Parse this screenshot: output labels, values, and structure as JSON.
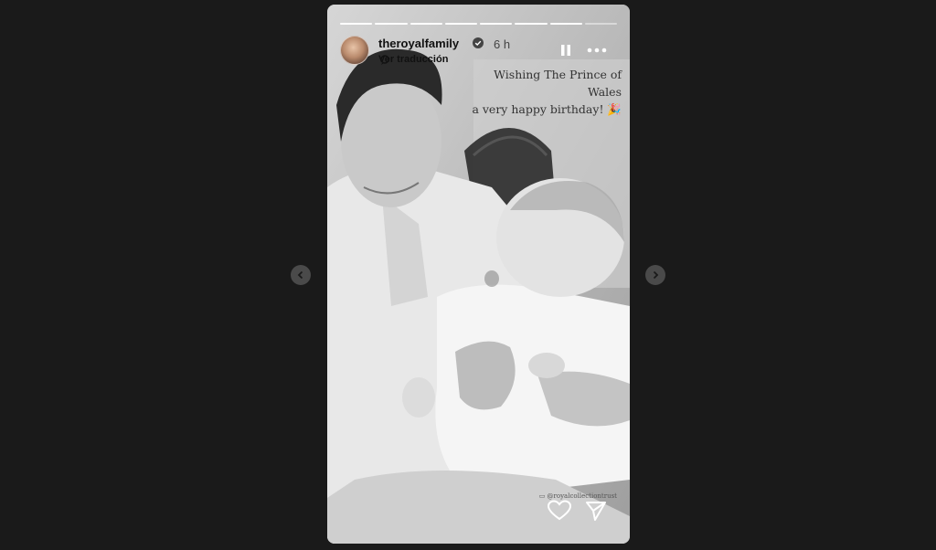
{
  "story": {
    "progress": {
      "segments": 8,
      "completed": 7
    },
    "user": {
      "username": "theroyalfamily",
      "verified": true,
      "time": "6 h",
      "translate_label": "Ver traducción"
    },
    "caption_line1": "Wishing The Prince of Wales",
    "caption_line2": "a very happy birthday! 🎉",
    "credit": "▭ @royalcollectiontrust",
    "icons": {
      "pause": "pause-icon",
      "more": "more-options-icon",
      "like": "heart-icon",
      "share": "send-icon",
      "prev": "chevron-left-icon",
      "next": "chevron-right-icon"
    }
  },
  "colors": {
    "background": "#1a1a1a",
    "nav_button": "#4a4a4a",
    "progress_active": "#ffffff"
  }
}
